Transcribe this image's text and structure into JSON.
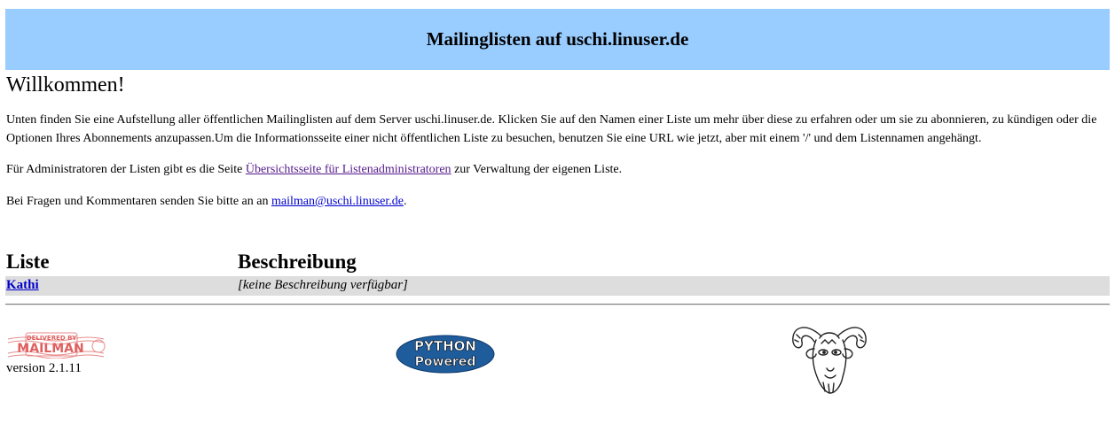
{
  "header": {
    "title": "Mailinglisten auf uschi.linuser.de"
  },
  "intro": {
    "heading": "Willkommen!",
    "paragraph": "Unten finden Sie eine Aufstellung aller öffentlichen Mailinglisten auf dem Server uschi.linuser.de. Klicken Sie auf den Namen einer Liste um mehr über diese zu erfahren oder um sie zu abonnieren, zu kündigen oder die Optionen Ihres Abonnements anzupassen.Um die Informationsseite einer nicht öffentlichen Liste zu besuchen, benutzen Sie eine URL wie jetzt, aber mit einem '/' und dem Listennamen angehängt.",
    "admin_prefix": "Für Administratoren der Listen gibt es die Seite ",
    "admin_link": "Übersichtsseite für Listenadministratoren",
    "admin_suffix": " zur Verwaltung der eigenen Liste.",
    "contact_prefix": "Bei Fragen und Kommentaren senden Sie bitte an an ",
    "contact_link": "mailman@uschi.linuser.de",
    "contact_suffix": "."
  },
  "table": {
    "headers": {
      "list": "Liste",
      "description": "Beschreibung"
    },
    "rows": [
      {
        "name": "Kathi",
        "description": "[keine Beschreibung verfügbar]"
      }
    ]
  },
  "footer": {
    "mailman_logo_top": "DELIVERED BY",
    "mailman_logo_main": "MAILMAN",
    "version": "version 2.1.11",
    "python_logo_top": "PYTHON",
    "python_logo_bottom": "Powered"
  },
  "colors": {
    "banner": "#99ccff",
    "row": "#dddddd",
    "link": "#0000cc",
    "visited_link": "#551a8b"
  }
}
